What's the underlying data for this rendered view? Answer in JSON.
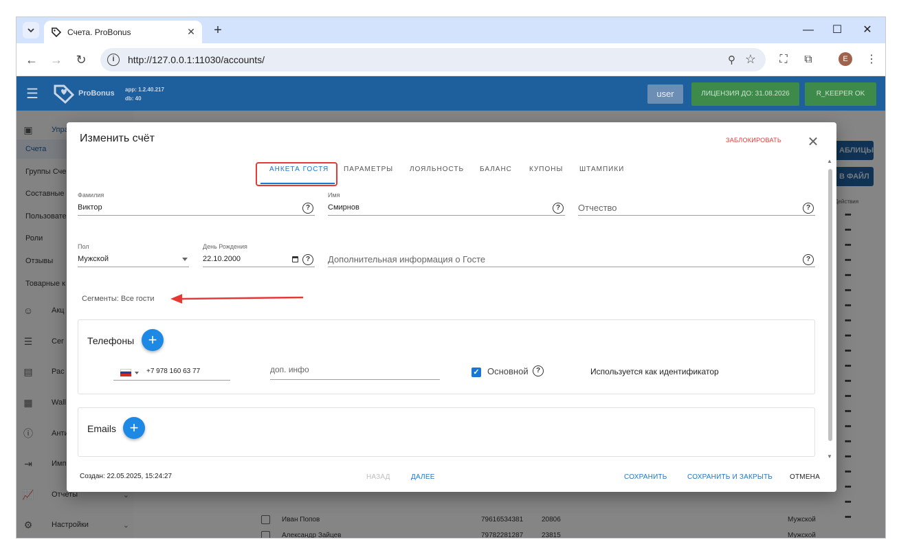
{
  "browser": {
    "tab_title": "Счета. ProBonus",
    "url": "http://127.0.0.1:11030/accounts/",
    "profile_initial": "E"
  },
  "appbar": {
    "brand": "ProBonus",
    "app_version": "app: 1.2.40.217",
    "db_version": "db: 40",
    "user_label": "user",
    "license_label": "ЛИЦЕНЗИЯ ДО: 31.08.2026",
    "rkeeper_label": "R_KEEPER OK"
  },
  "sidebar": {
    "items": [
      {
        "label": "Упра",
        "icon": "clipboard-icon"
      },
      {
        "label": "Счета"
      },
      {
        "label": "Группы Сче"
      },
      {
        "label": "Составные"
      },
      {
        "label": "Пользовате"
      },
      {
        "label": "Роли"
      },
      {
        "label": "Отзывы"
      },
      {
        "label": "Товарные к"
      },
      {
        "label": "Акц",
        "icon": "smile-icon"
      },
      {
        "label": "Сег",
        "icon": "list-icon"
      },
      {
        "label": "Рас",
        "icon": "card-icon"
      },
      {
        "label": "Wall",
        "icon": "wallet-icon"
      },
      {
        "label": "Анти",
        "icon": "alert-icon"
      },
      {
        "label": "Имп",
        "icon": "import-icon"
      },
      {
        "label": "Отчеты",
        "icon": "chart-icon"
      },
      {
        "label": "Настройки",
        "icon": "gear-icon"
      }
    ]
  },
  "background": {
    "btn_tables": "АБЛИЦЫ",
    "btn_file": "В ФАЙЛ",
    "col_actions": "Действия",
    "rows": [
      {
        "name": "Иван Попов",
        "phone": "79616534381",
        "id": "20806",
        "gender": "Мужской"
      },
      {
        "name": "Александр Зайцев",
        "phone": "79782281287",
        "id": "23815",
        "gender": "Мужской"
      }
    ]
  },
  "dialog": {
    "title": "Изменить счёт",
    "lock_label": "ЗАБЛОКИРОВАТЬ",
    "tabs": [
      "АНКЕТА ГОСТЯ",
      "ПАРАМЕТРЫ",
      "ЛОЯЛЬНОСТЬ",
      "БАЛАНС",
      "КУПОНЫ",
      "ШТАМПИКИ"
    ],
    "fields": {
      "last_name_label": "Фамилия",
      "last_name_value": "Виктор",
      "first_name_label": "Имя",
      "first_name_value": "Смирнов",
      "middle_name_placeholder": "Отчество",
      "gender_label": "Пол",
      "gender_value": "Мужской",
      "birthday_label": "День Рождения",
      "birthday_value": "22.10.2000",
      "extra_info_placeholder": "Дополнительная информация о Госте"
    },
    "segments_text": "Сегменты: Все гости",
    "phones": {
      "title": "Телефоны",
      "phone_value": "+7 978 160 63 77",
      "extra_placeholder": "доп. инфо",
      "primary_label": "Основной",
      "identifier_text": "Используется как идентификатор"
    },
    "emails": {
      "title": "Emails"
    },
    "footer": {
      "created": "Создан: 22.05.2025, 15:24:27",
      "back": "НАЗАД",
      "next": "ДАЛЕЕ",
      "save": "СОХРАНИТЬ",
      "save_close": "СОХРАНИТЬ И ЗАКРЫТЬ",
      "cancel": "ОТМЕНА"
    }
  },
  "colors": {
    "appbar": "#1e5f9e",
    "green": "#3d8a4a",
    "accent": "#1976d2",
    "danger": "#e53935"
  }
}
